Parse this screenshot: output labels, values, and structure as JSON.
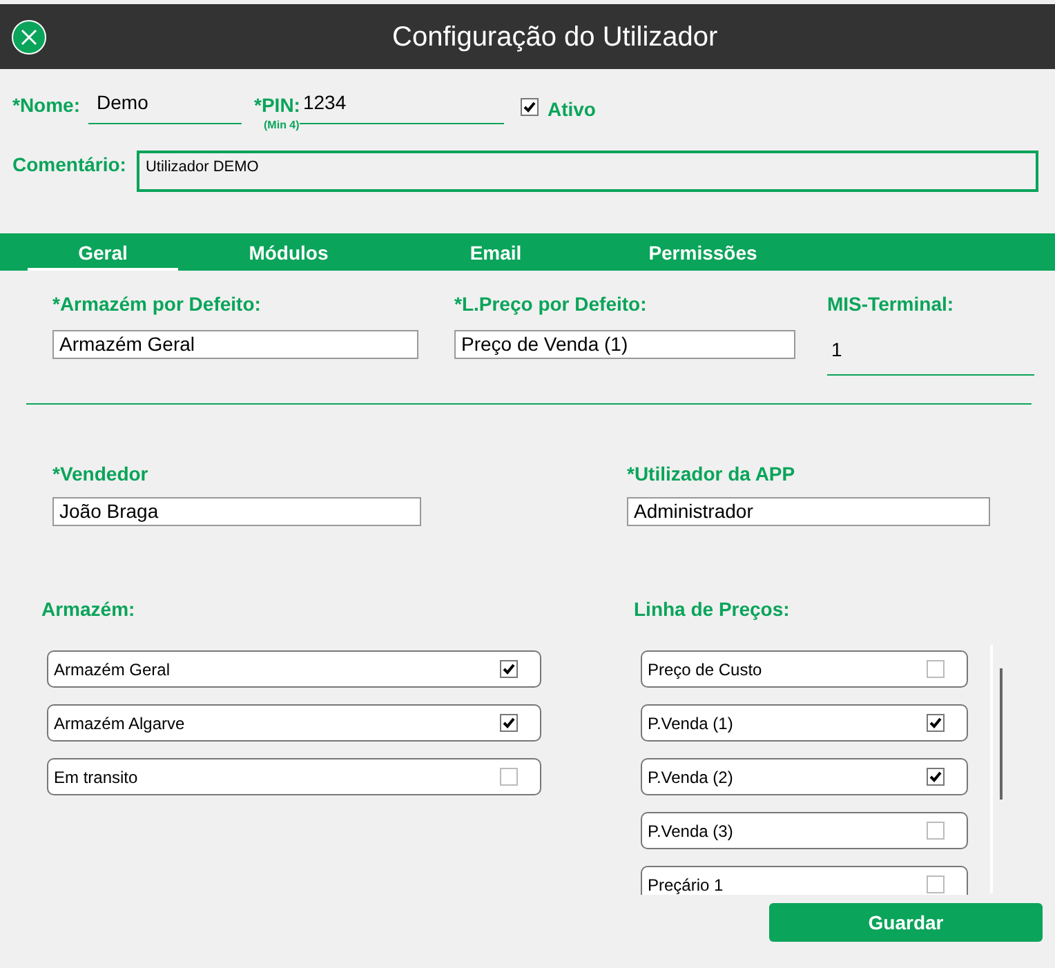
{
  "window": {
    "title": "Configuração do Utilizador"
  },
  "user": {
    "name_label": "*Nome:",
    "name": "Demo",
    "pin_label": "*PIN:",
    "pin_hint": "(Min 4)",
    "pin": "1234",
    "active_label": "Ativo",
    "active": true,
    "comment_label": "Comentário:",
    "comment": "Utilizador DEMO"
  },
  "tabs": [
    {
      "label": "Geral",
      "selected": true
    },
    {
      "label": "Módulos",
      "selected": false
    },
    {
      "label": "Email",
      "selected": false
    },
    {
      "label": "Permissões",
      "selected": false
    }
  ],
  "defaults": {
    "warehouse_label": "*Armazém por Defeito:",
    "warehouse": "Armazém Geral",
    "price_label": "*L.Preço por Defeito:",
    "price": "Preço de Venda (1)",
    "terminal_label": "MIS-Terminal:",
    "terminal": "1"
  },
  "people": {
    "seller_label": "*Vendedor",
    "seller": "João Braga",
    "app_user_label": "*Utilizador da APP",
    "app_user": "Administrador"
  },
  "warehouses": {
    "title": "Armazém:",
    "items": [
      {
        "label": "Armazém Geral",
        "checked": true
      },
      {
        "label": "Armazém Algarve",
        "checked": true
      },
      {
        "label": "Em transito",
        "checked": false
      }
    ]
  },
  "price_lines": {
    "title": "Linha de Preços:",
    "items": [
      {
        "label": "Preço de Custo",
        "checked": false
      },
      {
        "label": "P.Venda (1)",
        "checked": true
      },
      {
        "label": "P.Venda (2)",
        "checked": true
      },
      {
        "label": "P.Venda (3)",
        "checked": false
      },
      {
        "label": "Preçário 1",
        "checked": false
      }
    ]
  },
  "buttons": {
    "save": "Guardar"
  }
}
